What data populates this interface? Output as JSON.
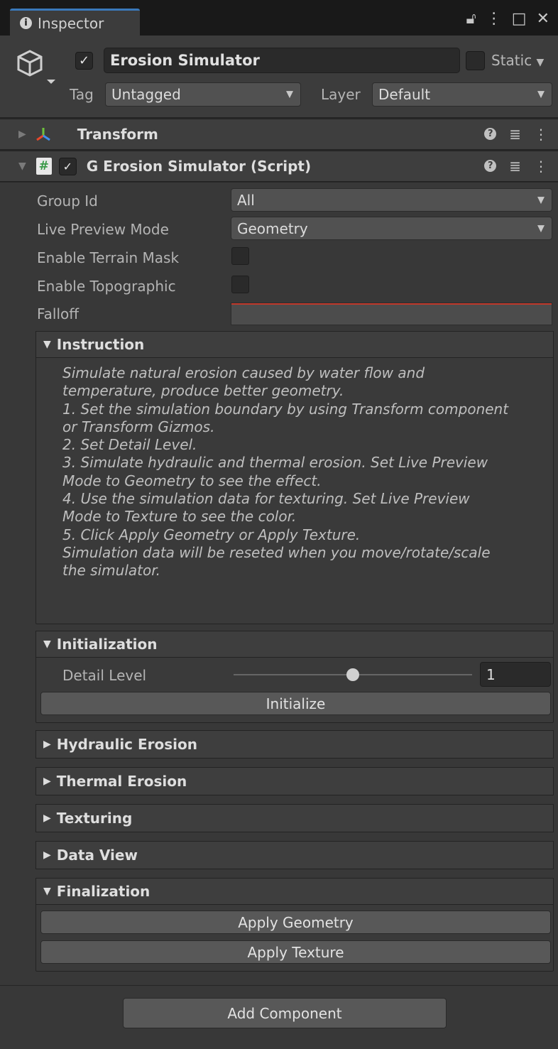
{
  "tab": {
    "title": "Inspector"
  },
  "header": {
    "object_name": "Erosion Simulator",
    "static_label": "Static",
    "tag_label": "Tag",
    "tag_value": "Untagged",
    "layer_label": "Layer",
    "layer_value": "Default"
  },
  "components": {
    "transform": "Transform",
    "script": "G Erosion Simulator (Script)"
  },
  "fields": {
    "group_id_label": "Group Id",
    "group_id_value": "All",
    "live_preview_label": "Live Preview Mode",
    "live_preview_value": "Geometry",
    "terrain_mask_label": "Enable Terrain Mask",
    "topographic_label": "Enable Topographic",
    "falloff_label": "Falloff"
  },
  "instruction": {
    "title": "Instruction",
    "lines": [
      "Simulate natural erosion caused by water flow and",
      "temperature, produce better geometry.",
      "1. Set the simulation boundary by using Transform component",
      "or Transform Gizmos.",
      "2. Set Detail Level.",
      "3. Simulate hydraulic and thermal erosion. Set Live Preview",
      "Mode to Geometry to see the effect.",
      "4. Use the simulation data for texturing. Set Live Preview",
      "Mode to Texture to see the color.",
      "5. Click Apply Geometry or Apply Texture.",
      "Simulation data will be reseted when you move/rotate/scale",
      "the simulator."
    ]
  },
  "initialization": {
    "title": "Initialization",
    "detail_label": "Detail Level",
    "detail_value": "1",
    "slider_fraction": 0.5,
    "initialize_button": "Initialize"
  },
  "sections": {
    "hydraulic": "Hydraulic Erosion",
    "thermal": "Thermal Erosion",
    "texturing": "Texturing",
    "data_view": "Data View"
  },
  "finalization": {
    "title": "Finalization",
    "apply_geometry": "Apply Geometry",
    "apply_texture": "Apply Texture"
  },
  "footer": {
    "add_component": "Add Component"
  },
  "colors": {
    "accent": "#3a79bb",
    "falloff_curve": "#c0392b",
    "script_icon": "#5fb86a"
  }
}
